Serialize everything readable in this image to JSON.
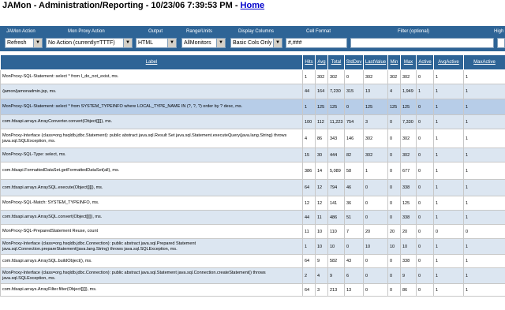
{
  "header": {
    "title": "JAMon - Administration/Reporting - 10/23/06 7:39:53 PM -",
    "home_link": "Home"
  },
  "controls": {
    "labels": [
      "JAMon Action",
      "Mon Proxy Action",
      "Output",
      "Range/Units",
      "Display Columns",
      "Cell Format",
      "Filter (optional)",
      "High"
    ],
    "action": "Refresh",
    "proxy_action": "No Action (currently=TTTF)",
    "output": "HTML",
    "range": "AllMonitors",
    "display": "Basic Cols Only",
    "cell_format": "#,###",
    "filter": ""
  },
  "table": {
    "columns": [
      "Label",
      "Hits",
      "Avg",
      "Total",
      "StdDev",
      "LastValue",
      "Min",
      "Max",
      "Active",
      "AvgActive",
      "MaxActive"
    ],
    "rows": [
      [
        "MonProxy-SQL-Statement: select * from I_do_not_exist, ms.",
        "1",
        "302",
        "302",
        "0",
        "302",
        "302",
        "302",
        "0",
        "1",
        "1"
      ],
      [
        "/jamon/jamonadmin.jsp, ms.",
        "44",
        "164",
        "7,230",
        "315",
        "13",
        "4",
        "1,949",
        "1",
        "1",
        "1"
      ],
      [
        "MonProxy-SQL-Statement: select * from SYSTEM_TYPEINFO where LOCAL_TYPE_NAME IN (?, ?, ?) order by ? desc, ms.",
        "1",
        "125",
        "125",
        "0",
        "125",
        "125",
        "125",
        "0",
        "1",
        "1"
      ],
      [
        "com.fdsapi.arrays.ArrayConverter.convert(Object[][]), ms.",
        "100",
        "112",
        "11,223",
        "754",
        "3",
        "0",
        "7,330",
        "0",
        "1",
        "1"
      ],
      [
        "MonProxy-Interface (class=org.hsqldb.jdbc.Statement): public abstract java.sql.Result Set java.sql.Statement.executeQuery(java.lang.String) throws java.sql.SQLException, ms.",
        "4",
        "86",
        "343",
        "146",
        "302",
        "0",
        "302",
        "0",
        "1",
        "1"
      ],
      [
        "MonProxy-SQL-Type: select, ms.",
        "15",
        "30",
        "444",
        "82",
        "302",
        "0",
        "302",
        "0",
        "1",
        "1"
      ],
      [
        "com.fdsapi.FormattedDataSet.getFormattedDataSet(all), ms.",
        "386",
        "14",
        "5,089",
        "58",
        "1",
        "0",
        "677",
        "0",
        "1",
        "1"
      ],
      [
        "com.fdsapi.arrays.ArraySQL.execute(Object[][]), ms.",
        "64",
        "12",
        "794",
        "46",
        "0",
        "0",
        "338",
        "0",
        "1",
        "1"
      ],
      [
        "MonProxy-SQL-Match: SYSTEM_TYPEINFO, ms.",
        "12",
        "12",
        "141",
        "36",
        "0",
        "0",
        "125",
        "0",
        "1",
        "1"
      ],
      [
        "com.fdsapi.arrays.ArraySQL.convert(Object[][]), ms.",
        "44",
        "11",
        "486",
        "51",
        "0",
        "0",
        "338",
        "0",
        "1",
        "1"
      ],
      [
        "MonProxy-SQL-PreparedStatement Reuse, count",
        "11",
        "10",
        "110",
        "7",
        "20",
        "20",
        "20",
        "0",
        "0",
        "0"
      ],
      [
        "MonProxy-Interface (class=org.hsqldb.jdbc.Connection): public abstract java.sql.Prepared Statement java.sql.Connection.prepareStatement(java.lang.String) throws java.sql.SQLException, ms.",
        "1",
        "10",
        "10",
        "0",
        "10",
        "10",
        "10",
        "0",
        "1",
        "1"
      ],
      [
        "com.fdsapi.arrays.ArraySQL.buildObject(), ms.",
        "64",
        "9",
        "582",
        "43",
        "0",
        "0",
        "338",
        "0",
        "1",
        "1"
      ],
      [
        "MonProxy-Interface (class=org.hsqldb.jdbc.Connection): public abstract java.sql.Statement java.sql.Connection.createStatement() throws java.sql.SQLException, ms.",
        "2",
        "4",
        "9",
        "6",
        "0",
        "0",
        "9",
        "0",
        "1",
        "1"
      ],
      [
        "com.fdsapi.arrays.ArrayFilter.filter(Object[][]), ms.",
        "64",
        "3",
        "213",
        "13",
        "0",
        "0",
        "86",
        "0",
        "1",
        "1"
      ]
    ]
  }
}
